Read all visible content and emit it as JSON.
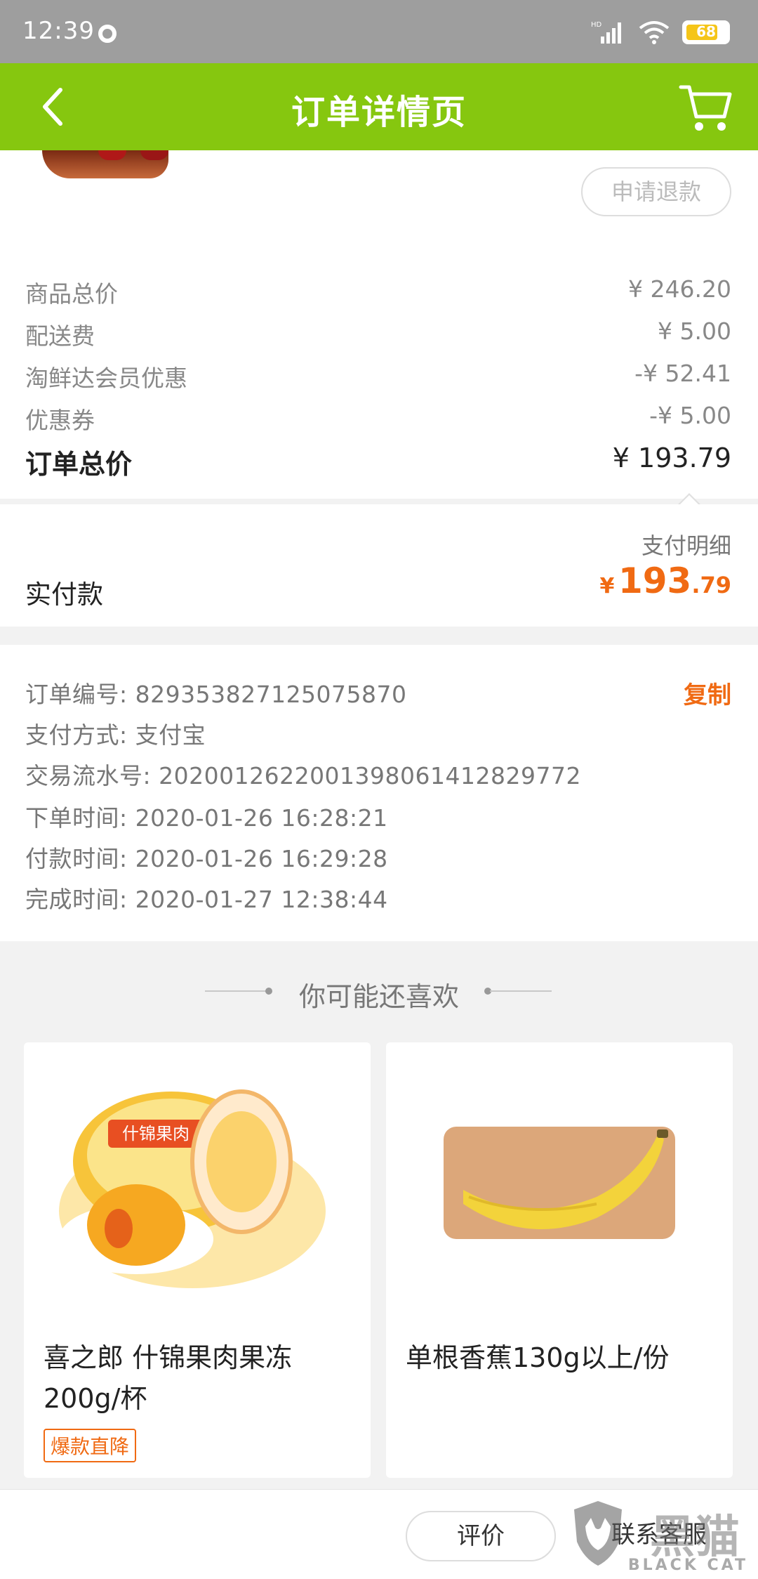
{
  "status_bar": {
    "time": "12:39",
    "network": "HD",
    "battery": "68"
  },
  "header": {
    "title": "订单详情页"
  },
  "top": {
    "refund_label": "申请退款"
  },
  "fees": [
    {
      "label": "商品总价",
      "value": "¥ 246.20"
    },
    {
      "label": "配送费",
      "value": "¥ 5.00"
    },
    {
      "label": "淘鲜达会员优惠",
      "value": "-¥ 52.41"
    },
    {
      "label": "优惠券",
      "value": "-¥ 5.00"
    }
  ],
  "total": {
    "label": "订单总价",
    "value": "¥ 193.79"
  },
  "payment": {
    "detail_link": "支付明细",
    "paid_label": "实付款",
    "currency": "¥",
    "amount_int": "193",
    "amount_dec": ".79"
  },
  "order_info": {
    "copy_label": "复制",
    "rows": [
      "订单编号: 829353827125075870",
      "支付方式: 支付宝",
      "交易流水号: 2020012622001398061412829772",
      "下单时间: 2020-01-26 16:28:21",
      "付款时间: 2020-01-26 16:29:28",
      "完成时间: 2020-01-27 12:38:44"
    ]
  },
  "recommend": {
    "title": "你可能还喜欢",
    "products": [
      {
        "name": "喜之郎 什锦果肉果冻200g/杯",
        "tag": "爆款直降",
        "image_icon": "jelly-cup-icon",
        "package_label": "什锦果肉"
      },
      {
        "name": "单根香蕉130g以上/份",
        "image_icon": "banana-icon"
      }
    ]
  },
  "bottom_bar": {
    "review_label": "评价",
    "service_label": "联系客服"
  },
  "watermark": {
    "text": "BLACK CAT",
    "big": "黑猫"
  },
  "colors": {
    "header_green": "#86c70f",
    "accent_orange": "#f06a13"
  }
}
